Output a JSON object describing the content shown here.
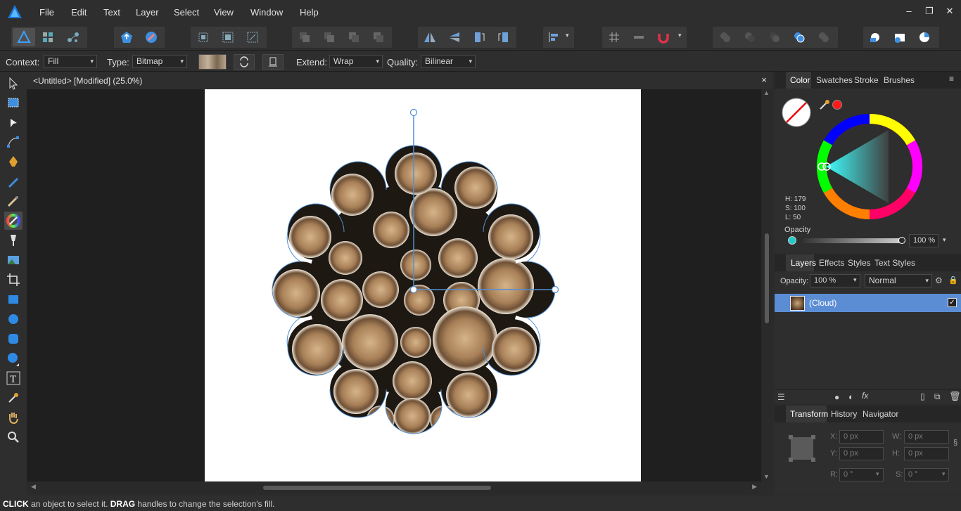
{
  "menubar": {
    "items": [
      "File",
      "Edit",
      "Text",
      "Layer",
      "Select",
      "View",
      "Window",
      "Help"
    ]
  },
  "context": {
    "context_label": "Context:",
    "context_value": "Fill",
    "type_label": "Type:",
    "type_value": "Bitmap",
    "extend_label": "Extend:",
    "extend_value": "Wrap",
    "quality_label": "Quality:",
    "quality_value": "Bilinear"
  },
  "document": {
    "title": "<Untitled> [Modified] (25.0%)",
    "close": "×"
  },
  "color_panel": {
    "tabs": [
      "Color",
      "Swatches",
      "Stroke",
      "Brushes"
    ],
    "h": "H: 179",
    "s": "S: 100",
    "l": "L: 50",
    "opacity_label": "Opacity",
    "opacity_value": "100 %",
    "accent_color": "#1ecbcb",
    "swatch_red": "#ff1a1a"
  },
  "layers_panel": {
    "tabs": [
      "Layers",
      "Effects",
      "Styles",
      "Text Styles"
    ],
    "opacity_label": "Opacity:",
    "opacity_value": "100 %",
    "blend_mode": "Normal",
    "layer_name": "(Cloud)",
    "layer_visible": true,
    "selected_color": "#5b8dd4"
  },
  "transform_panel": {
    "tabs": [
      "Transform",
      "History",
      "Navigator"
    ],
    "x_label": "X:",
    "x_value": "0 px",
    "y_label": "Y:",
    "y_value": "0 px",
    "w_label": "W:",
    "w_value": "0 px",
    "h_label": "H:",
    "h_value": "0 px",
    "r_label": "R:",
    "r_value": "0 °",
    "s_label": "S:",
    "s_value": "0 °"
  },
  "status": {
    "click": "CLICK",
    "click_text": " an object to select it. ",
    "drag": "DRAG",
    "drag_text": " handles to change the selection's fill."
  }
}
